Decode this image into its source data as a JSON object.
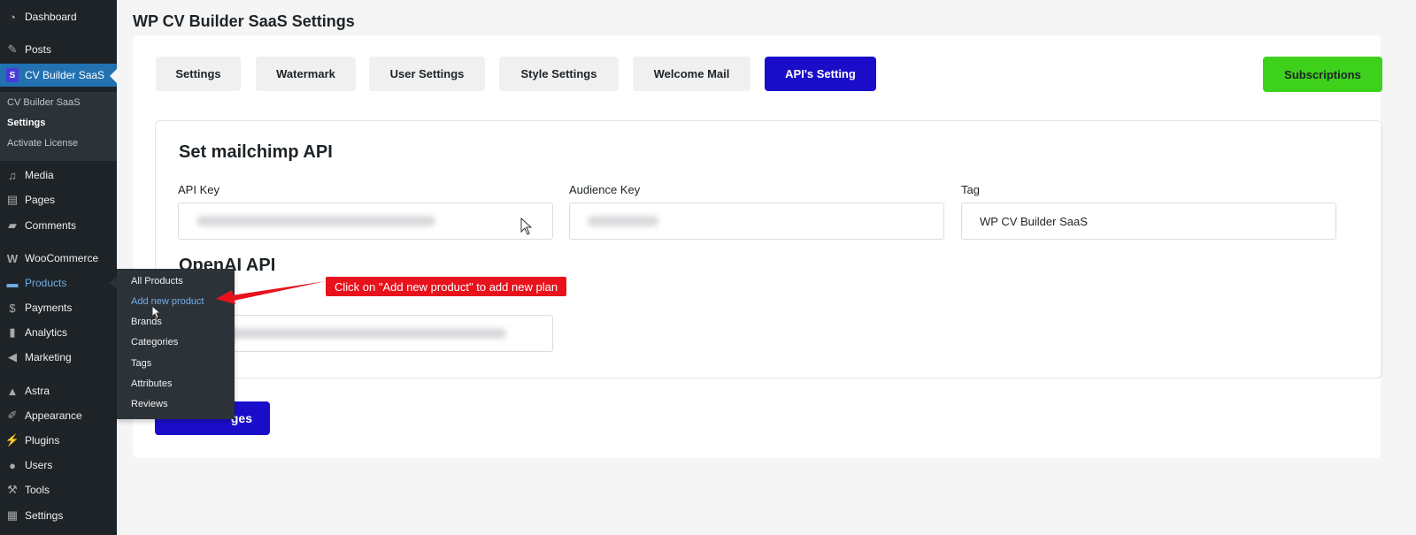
{
  "page": {
    "title": "WP CV Builder SaaS Settings"
  },
  "sidebar": {
    "items": [
      {
        "label": "Dashboard",
        "icon": "dashboard-icon"
      },
      {
        "label": "Posts",
        "icon": "pin-icon"
      },
      {
        "label": "CV Builder SaaS",
        "icon": "cv-builder-icon",
        "icon_glyph": "S"
      },
      {
        "label": "Media",
        "icon": "media-icon"
      },
      {
        "label": "Pages",
        "icon": "pages-icon"
      },
      {
        "label": "Comments",
        "icon": "comments-icon"
      },
      {
        "label": "WooCommerce",
        "icon": "woocommerce-icon"
      },
      {
        "label": "Products",
        "icon": "products-icon"
      },
      {
        "label": "Payments",
        "icon": "payments-icon"
      },
      {
        "label": "Analytics",
        "icon": "analytics-icon"
      },
      {
        "label": "Marketing",
        "icon": "megaphone-icon"
      },
      {
        "label": "Astra",
        "icon": "astra-icon"
      },
      {
        "label": "Appearance",
        "icon": "brush-icon"
      },
      {
        "label": "Plugins",
        "icon": "plugin-icon"
      },
      {
        "label": "Users",
        "icon": "users-icon"
      },
      {
        "label": "Tools",
        "icon": "wrench-icon"
      },
      {
        "label": "Settings",
        "icon": "settings-icon"
      }
    ],
    "submenu": [
      "CV Builder SaaS",
      "Settings",
      "Activate License"
    ],
    "products_flyout": [
      "All Products",
      "Add new product",
      "Brands",
      "Categories",
      "Tags",
      "Attributes",
      "Reviews"
    ]
  },
  "tabs": [
    "Settings",
    "Watermark",
    "User Settings",
    "Style Settings",
    "Welcome Mail",
    "API's Setting"
  ],
  "active_tab": "API's Setting",
  "subscriptions_label": "Subscriptions",
  "mailchimp": {
    "title": "Set mailchimp API",
    "api_key_label": "API Key",
    "audience_key_label": "Audience Key",
    "tag_label": "Tag",
    "tag_value": "WP CV Builder SaaS"
  },
  "openai": {
    "title": "OpenAI API"
  },
  "save_label": "ges",
  "annotation": {
    "text": "Click on \"Add new product\" to add new plan"
  },
  "colors": {
    "primary": "#1a0dc9",
    "success": "#3ed11c",
    "sidebar": "#1d2327",
    "annotation": "#e8121c"
  }
}
